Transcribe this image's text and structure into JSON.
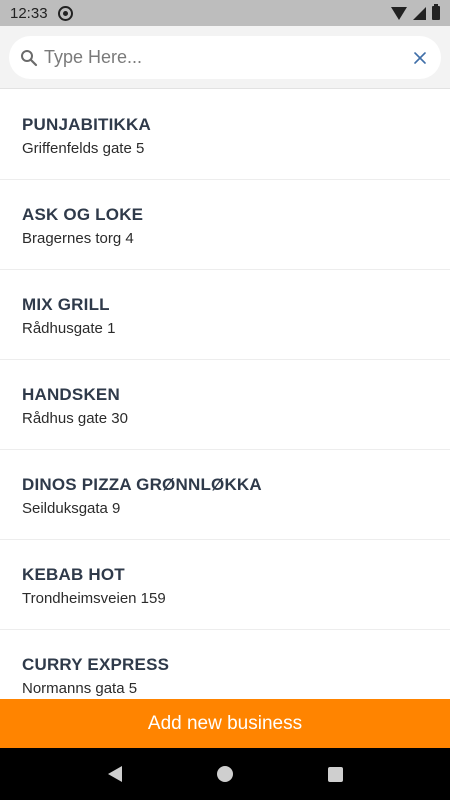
{
  "status_bar": {
    "time": "12:33",
    "icons": [
      "sync-icon",
      "wifi-icon",
      "signal-icon",
      "battery-icon"
    ]
  },
  "search": {
    "placeholder": "Type Here...",
    "value": ""
  },
  "businesses": [
    {
      "name": "PUNJABITIKKA",
      "address": "Griffenfelds gate 5"
    },
    {
      "name": "ASK OG LOKE",
      "address": "Bragernes torg 4"
    },
    {
      "name": "MIX GRILL",
      "address": "Rådhusgate 1"
    },
    {
      "name": "HANDSKEN",
      "address": "Rådhus gate 30"
    },
    {
      "name": "DINOS PIZZA GRØNNLØKKA",
      "address": "Seilduksgata 9"
    },
    {
      "name": "KEBAB HOT",
      "address": "Trondheimsveien 159"
    },
    {
      "name": "CURRY EXPRESS",
      "address": "Normanns gata 5"
    }
  ],
  "add_button": {
    "label": "Add new business"
  },
  "colors": {
    "accent": "#ff8400",
    "title_text": "#2f3a4a",
    "status_bar": "#bdbdbd"
  },
  "nav_bar": {
    "icons": [
      "back-icon",
      "home-icon",
      "recent-apps-icon"
    ]
  }
}
